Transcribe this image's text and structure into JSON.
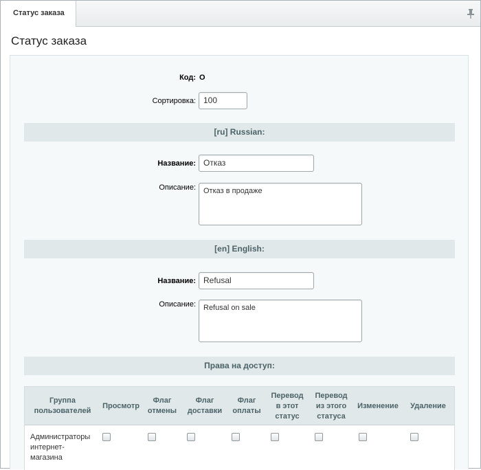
{
  "tab": {
    "label": "Статус заказа"
  },
  "page": {
    "title": "Статус заказа"
  },
  "form": {
    "code_label": "Код:",
    "code_value": "O",
    "sort_label": "Сортировка:",
    "sort_value": "100"
  },
  "sections": {
    "ru": {
      "header": "[ru] Russian:",
      "name_label": "Название:",
      "name_value": "Отказ",
      "desc_label": "Описание:",
      "desc_value": "Отказ в продаже"
    },
    "en": {
      "header": "[en] English:",
      "name_label": "Название:",
      "name_value": "Refusal",
      "desc_label": "Описание:",
      "desc_value": "Refusal on sale"
    }
  },
  "access": {
    "header": "Права на доступ:",
    "columns": [
      "Группа пользователей",
      "Просмотр",
      "Флаг отмены",
      "Флаг доставки",
      "Флаг оплаты",
      "Перевод в этот статус",
      "Перевод из этого статуса",
      "Изменение",
      "Удаление"
    ],
    "rows": [
      {
        "group": "Администраторы интернет-магазина"
      }
    ]
  }
}
